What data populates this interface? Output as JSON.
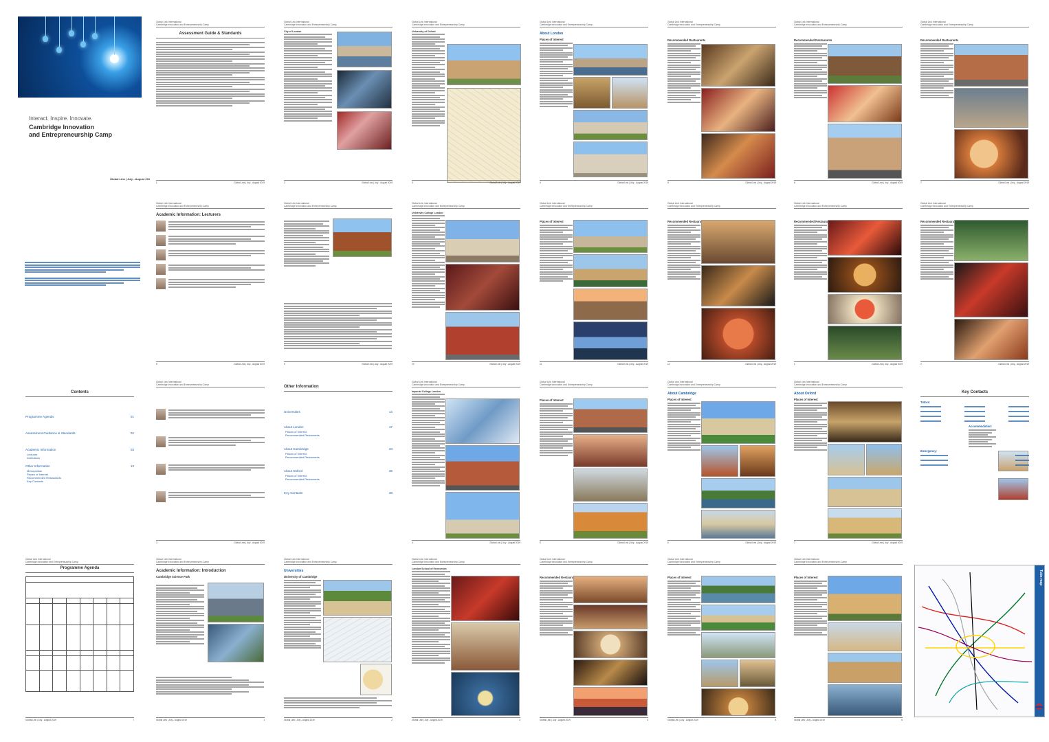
{
  "cover": {
    "tagline": "Interact. Inspire. Innovate.",
    "title_line1": "Cambridge Innovation",
    "title_line2": "and Entrepreneurship Camp",
    "dates": "Global Link | July - August 2019"
  },
  "running_header": {
    "org": "Global Link International",
    "camp": "Cambridge Innovation and Entrepreneurship Camp"
  },
  "running_footer": "Global Link | July - August 2019",
  "pages": {
    "assessment": {
      "title": "Assessment Guide & Standards"
    },
    "academic_lecturers": {
      "title": "Academic Information: Lecturers"
    },
    "academic_introduction": {
      "title": "Academic Information: Introduction",
      "subtitle": "Cambridge Science Park"
    },
    "programme_agenda": {
      "title": "Programme Agenda"
    },
    "contents": {
      "title": "Contents"
    },
    "other_info": {
      "title": "Other Information"
    },
    "universities": {
      "title": "Universities",
      "subtitle": "University of Cambridge"
    },
    "about_london": {
      "title": "About London",
      "subtitle": "Places of Interest"
    },
    "about_cambridge": {
      "title": "About Cambridge",
      "subtitle": "Places of Interest"
    },
    "about_oxford": {
      "title": "About Oxford",
      "subtitle": "Places of Interest"
    },
    "key_contacts": {
      "title": "Key Contacts"
    },
    "places": "Places of Interest",
    "restaurants": "Recommended Restaurants",
    "oxford_uni": "University of Oxford",
    "ucl": "University College London",
    "imperial": "Imperial College London",
    "lse": "London School of Economics",
    "city_of_london": "City of London",
    "tube_map": "Tube map"
  },
  "contents_entries": [
    {
      "label": "Programme Agenda",
      "page": "01"
    },
    {
      "label": "Assessment Guidance & Standards",
      "page": "02"
    },
    {
      "label": "Academic Information",
      "page": "03"
    },
    {
      "label": "Other Information",
      "page": "13"
    }
  ],
  "contents_sub": {
    "academic": [
      "Lectures",
      "Institutions"
    ],
    "other": [
      "Metropolitan",
      "Places of Interest",
      "Recommended Restaurants",
      "Key Contacts"
    ]
  },
  "other_info_entries": [
    {
      "label": "Universities",
      "page": "14"
    },
    {
      "label": "About London",
      "page": "17"
    },
    {
      "label": "About Cambridge",
      "page": "23"
    },
    {
      "label": "About Oxford",
      "page": "26"
    },
    {
      "label": "Key Contacts",
      "page": "28"
    }
  ],
  "other_info_sub": [
    "Places of Interest",
    "Recommended Restaurants"
  ],
  "key_contacts": {
    "tutors_label": "Tutors:",
    "accommodation_label": "Accommodation:",
    "emergency_label": "Emergency:"
  },
  "page_numbers": [
    "i",
    "1",
    "2",
    "3",
    "4",
    "5",
    "6",
    "7",
    "8",
    "9",
    "10",
    "11",
    "12"
  ]
}
